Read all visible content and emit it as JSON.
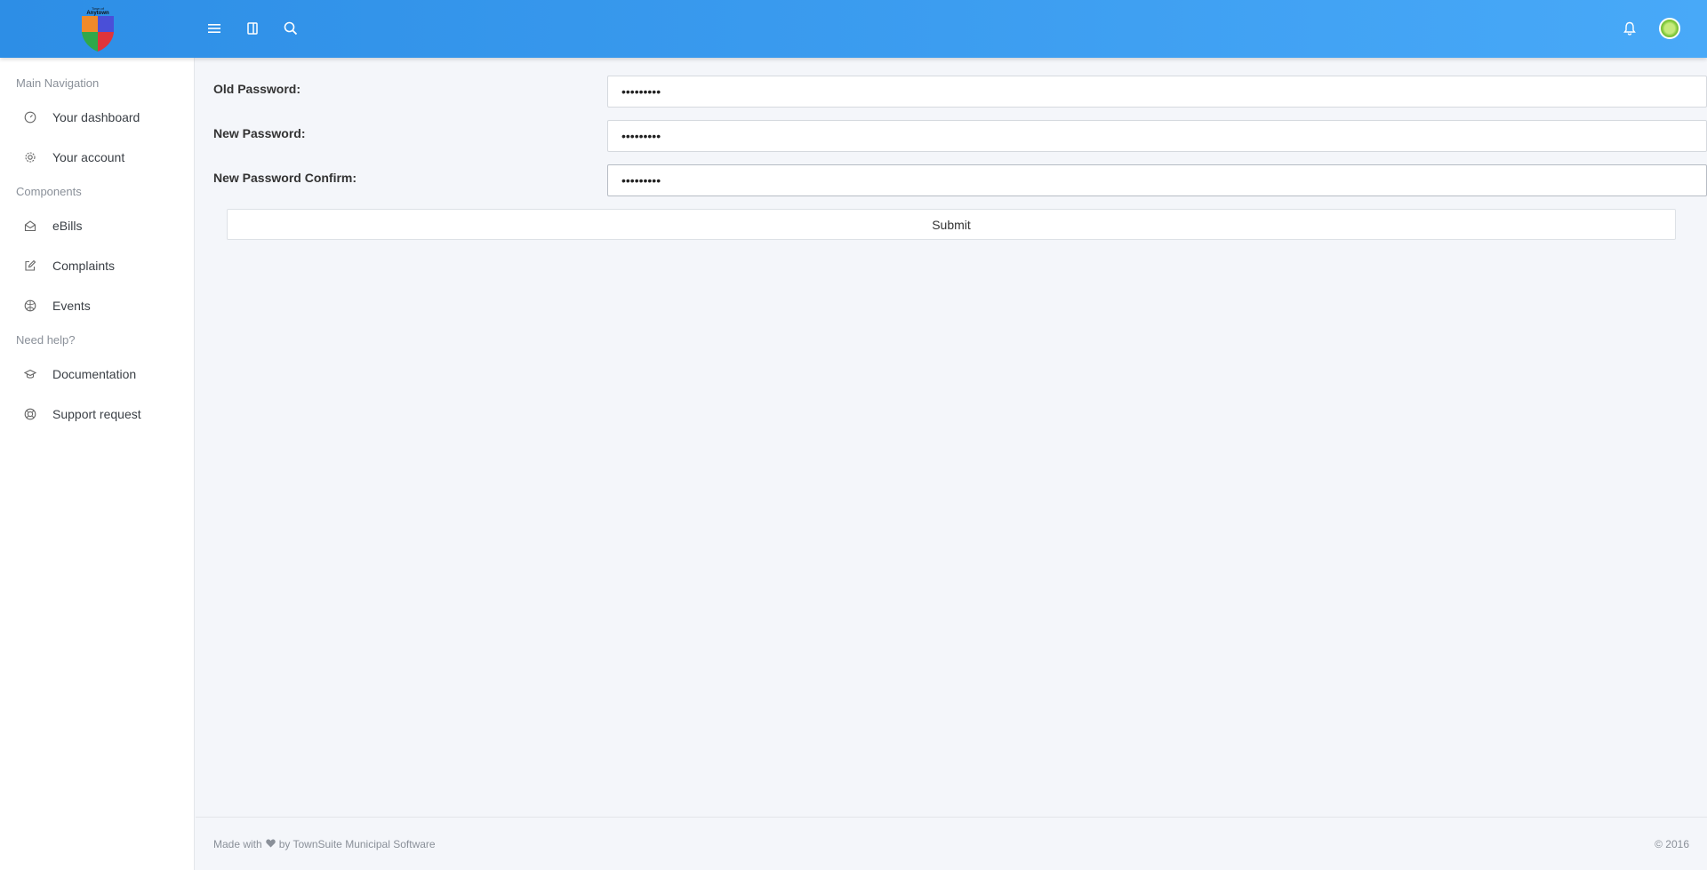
{
  "topbar": {
    "logo_text": "Anytown",
    "icons": [
      "menu-icon",
      "sidebar-toggle-icon",
      "search-icon",
      "bell-icon"
    ],
    "accent": "#3a9cf0"
  },
  "sidebar": {
    "sections": [
      {
        "title": "Main Navigation",
        "items": [
          {
            "label": "Your dashboard",
            "icon": "speedometer-icon"
          },
          {
            "label": "Your account",
            "icon": "gear-icon"
          }
        ]
      },
      {
        "title": "Components",
        "items": [
          {
            "label": "eBills",
            "icon": "envelope-open-icon"
          },
          {
            "label": "Complaints",
            "icon": "edit-icon"
          },
          {
            "label": "Events",
            "icon": "ball-icon"
          }
        ]
      },
      {
        "title": "Need help?",
        "items": [
          {
            "label": "Documentation",
            "icon": "graduation-cap-icon"
          },
          {
            "label": "Support request",
            "icon": "lifebuoy-icon"
          }
        ]
      }
    ]
  },
  "form": {
    "old_password_label": "Old Password:",
    "old_password_value": "•••••••••",
    "new_password_label": "New Password:",
    "new_password_value": "•••••••••",
    "confirm_password_label": "New Password Confirm:",
    "confirm_password_value": "•••••••••",
    "submit_label": "Submit"
  },
  "footer": {
    "made_with": "Made with",
    "by": "by TownSuite Municipal Software",
    "copyright": "© 2016"
  }
}
